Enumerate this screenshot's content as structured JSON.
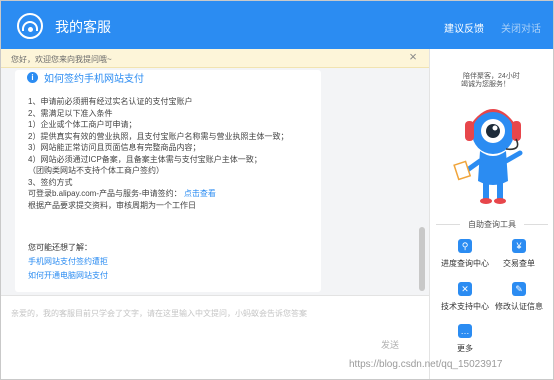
{
  "header": {
    "title": "我的客服",
    "feedback_label": "建议反馈",
    "close_label": "关闭对话"
  },
  "notice": {
    "text": "您好，欢迎您来向我提问哦~",
    "close_glyph": "×"
  },
  "message": {
    "title": "如何签约手机网站支付",
    "lines": [
      "1、申请前必须拥有经过实名认证的支付宝账户",
      "2、需满足以下准入条件",
      "1）企业或个体工商户可申请；",
      "2）提供真实有效的营业执照，且支付宝账户名称需与营业执照主体一致；",
      "3）网站能正常访问且页面信息有完整商品内容；",
      "4）网站必须通过ICP备案，且备案主体需与支付宝账户主体一致；",
      "（团购类网站不支持个体工商户签约）",
      "3、签约方式",
      "可登录b.alipay.com-产品与服务-申请签约：",
      "根据产品要求提交资料，审核周期为一个工作日"
    ],
    "view_link": "点击查看",
    "maybe_label": "您可能还想了解：",
    "suggestions": [
      "手机网站支付签约遭拒",
      "如何开通电脑网站支付"
    ]
  },
  "input": {
    "placeholder": "亲爱的，我的客服目前只学会了文字，请在这里输入中文提问，小蚂蚁会告诉您答案",
    "send_label": "发送"
  },
  "side": {
    "tagline1": "陪伴聚客，24小时",
    "tagline2": "竭诚为您服务！",
    "tools_title": "自助查询工具",
    "tools": [
      {
        "label": "进度查询中心",
        "icon": "progress-search-icon",
        "glyph": "⚲"
      },
      {
        "label": "交易查单",
        "icon": "order-document-icon",
        "glyph": "¥"
      },
      {
        "label": "技术支持中心",
        "icon": "wrench-tools-icon",
        "glyph": "✕"
      },
      {
        "label": "修改认证信息",
        "icon": "edit-pencil-icon",
        "glyph": "✎"
      },
      {
        "label": "更多",
        "icon": "more-icon",
        "glyph": "…"
      }
    ]
  },
  "watermark": "https://blog.csdn.net/qq_15023917",
  "colors": {
    "header": "#2b8cf2",
    "accent": "#2b8cf2",
    "notice_bg": "#fdf5d9",
    "chat_bg": "#f3f4f6"
  }
}
